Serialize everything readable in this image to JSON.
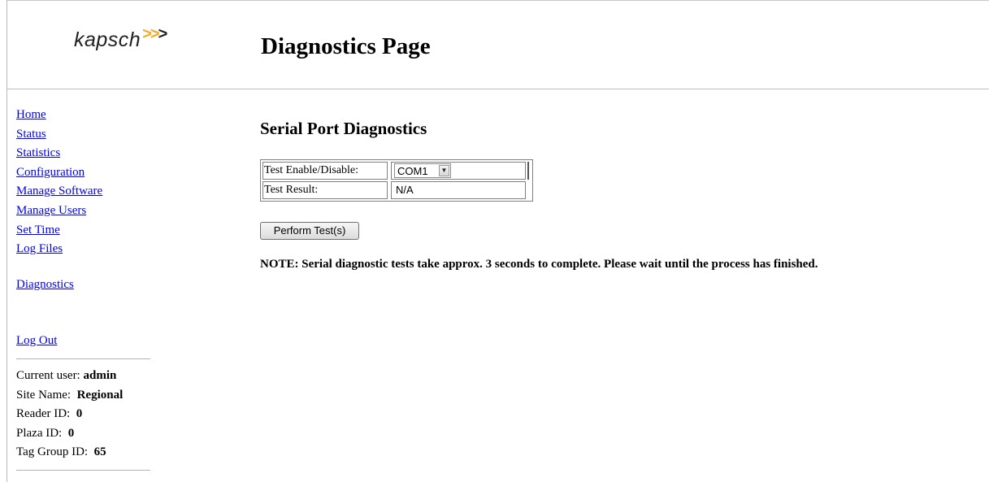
{
  "header": {
    "logo_text": "kapsch",
    "logo_arrows": ">>",
    "logo_arrow_last": ">",
    "page_title": "Diagnostics Page"
  },
  "colors": {
    "link": "#0000ee",
    "logo_arrow": "#f7a823",
    "rule": "#bdbdbd"
  },
  "sidebar": {
    "nav": [
      {
        "label": "Home"
      },
      {
        "label": "Status"
      },
      {
        "label": "Statistics"
      },
      {
        "label": "Configuration"
      },
      {
        "label": "Manage Software"
      },
      {
        "label": "Manage Users"
      },
      {
        "label": "Set Time"
      },
      {
        "label": "Log Files"
      }
    ],
    "diagnostics_label": "Diagnostics",
    "logout_label": "Log Out",
    "info": {
      "current_user_label": "Current user:",
      "current_user_value": "admin",
      "site_name_label": "Site Name:",
      "site_name_value": "Regional",
      "reader_id_label": "Reader ID:",
      "reader_id_value": "0",
      "plaza_id_label": "Plaza ID:",
      "plaza_id_value": "0",
      "tag_group_label": "Tag Group ID:",
      "tag_group_value": "65"
    }
  },
  "main": {
    "section_title": "Serial Port Diagnostics",
    "table": {
      "row1_label": "Test Enable/Disable:",
      "row1_select_value": "COM1",
      "row2_label": "Test Result:",
      "row2_value": "N/A"
    },
    "perform_button_label": "Perform Test(s)",
    "note": "NOTE: Serial diagnostic tests take approx. 3 seconds to complete. Please wait until the process has finished."
  }
}
